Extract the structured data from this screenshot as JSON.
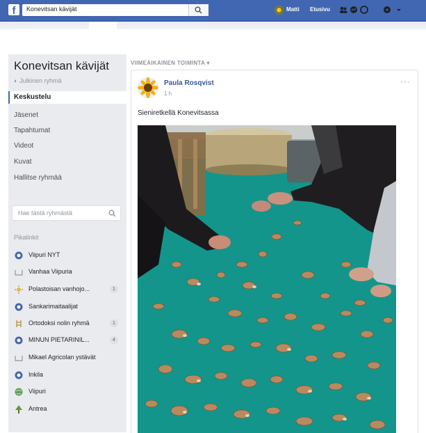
{
  "topbar": {
    "search_value": "Konevitsan kävijät",
    "user_name": "Matti",
    "home_label": "Etusivu",
    "icons": [
      "facebook-logo",
      "search-icon",
      "friends-icon",
      "messages-icon",
      "notifications-icon",
      "help-icon"
    ]
  },
  "sidebar": {
    "group_title": "Konevitsan kävijät",
    "privacy": "Julkinen ryhmä",
    "nav": [
      {
        "label": "Keskustelu",
        "active": true
      },
      {
        "label": "Jäsenet"
      },
      {
        "label": "Tapahtumat"
      },
      {
        "label": "Videot"
      },
      {
        "label": "Kuvat"
      },
      {
        "label": "Hallitse ryhmää"
      }
    ],
    "search_placeholder": "Hae tästä ryhmästä",
    "shortcuts_label": "Pikalinkit",
    "shortcuts": [
      {
        "label": "Viipuri NYT",
        "icon": "blue-circle",
        "count": ""
      },
      {
        "label": "Vanhaa Viipuria",
        "icon": "book",
        "count": ""
      },
      {
        "label": "Polastoisan vanhojo...",
        "icon": "sun",
        "count": "1"
      },
      {
        "label": "Sankarimaitaalijat",
        "icon": "blue-circle",
        "count": ""
      },
      {
        "label": "Ortodoksi nolin ryhmä",
        "icon": "ladder",
        "count": "1"
      },
      {
        "label": "MINUN PIETARINIL...",
        "icon": "blue-circle",
        "count": "4"
      },
      {
        "label": "Mikael Agricolan ystävät",
        "icon": "book",
        "count": ""
      },
      {
        "label": "Inkila",
        "icon": "blue-circle",
        "count": ""
      },
      {
        "label": "Viipuri",
        "icon": "globe",
        "count": ""
      },
      {
        "label": "Antrea",
        "icon": "tree",
        "count": ""
      }
    ]
  },
  "main": {
    "filter_label": "VIIMEAIKAINEN TOIMINTA",
    "post": {
      "author": "Paula Rosqvist",
      "time": "1 h",
      "more": "···",
      "text": "Sieniretkellä Konevitsassa"
    }
  },
  "colors": {
    "brand": "#4267b2",
    "link": "#365899",
    "sidebar_bg": "#e9ebee"
  }
}
